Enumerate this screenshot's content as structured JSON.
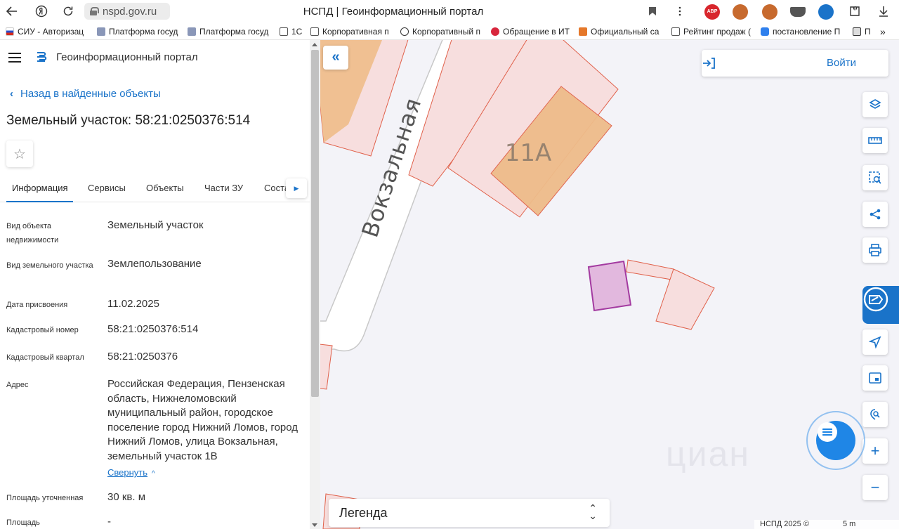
{
  "browser": {
    "url": "nspd.gov.ru",
    "tab_title": "НСПД | Геоинформационный портал",
    "bookmarks": [
      "СИУ - Авторизац",
      "Платформа госуд",
      "Платформа госуд",
      "1С",
      "Корпоративная п",
      "Корпоративный п",
      "Обращение в ИТ",
      "Официальный са",
      "Рейтинг продаж (",
      "постановление П",
      "П"
    ],
    "more_bookmarks": "»"
  },
  "app": {
    "name": "Геоинформационный портал",
    "back_link": "Назад в найденные объекты",
    "title": "Земельный участок: 58:21:0250376:514"
  },
  "tabs": [
    "Информация",
    "Сервисы",
    "Объекты",
    "Части ЗУ",
    "Соста"
  ],
  "properties": [
    {
      "label": "Вид объекта недвижимости",
      "value": "Земельный участок"
    },
    {
      "label": "Вид земельного участка",
      "value": "Землепользование"
    },
    {
      "label": "Дата присвоения",
      "value": "11.02.2025"
    },
    {
      "label": "Кадастровый номер",
      "value": "58:21:0250376:514"
    },
    {
      "label": "Кадастровый квартал",
      "value": "58:21:0250376"
    },
    {
      "label": "Адрес",
      "value": "Российская Федерация, Пензенская область, Нижнеломовский муниципальный район, городское поселение город Нижний Ломов, город Нижний Ломов, улица Вокзальная, земельный участок 1В"
    },
    {
      "label": "Площадь уточненная",
      "value": "30 кв. м"
    },
    {
      "label": "Площадь",
      "value": "-"
    }
  ],
  "collapse_link": "Свернуть",
  "map": {
    "street_label": "Вокзальная",
    "building_label": "11А",
    "login_label": "Войти",
    "legend_label": "Легенда",
    "attribution": "НСПД 2025 ©",
    "scale": "5 m",
    "watermark": "циан"
  },
  "colors": {
    "accent": "#1a73c9",
    "parcel_fill": "#f7dede",
    "parcel_stroke": "#e0604a",
    "building_fill": "#eebc8a",
    "selected_fill": "#e2b8de",
    "selected_stroke": "#a33aa0"
  }
}
